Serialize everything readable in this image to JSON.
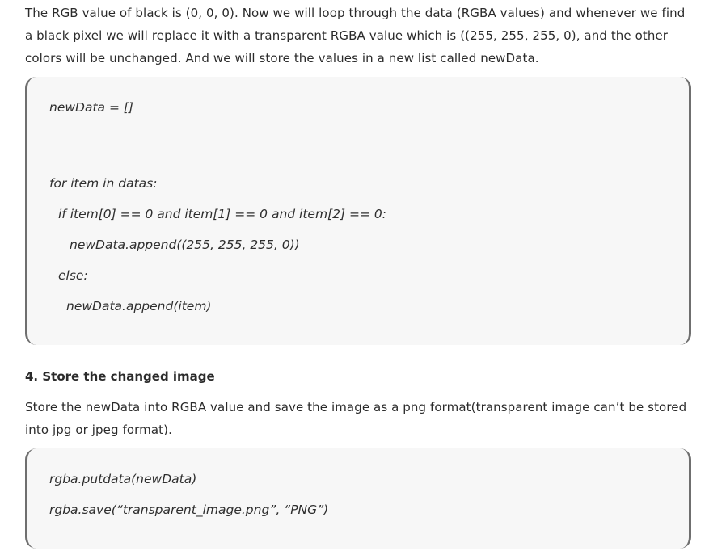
{
  "paragraphs": {
    "intro": "The RGB value of black is (0, 0, 0). Now we will loop through the data (RGBA values) and whenever we find a black pixel we will replace it with a transparent RGBA value which is ((255, 255, 255, 0), and the other colors will be unchanged.  And we will store the values in a new list called newData.",
    "store": "Store the newData into RGBA value and save the image as a png format(transparent image can’t be stored into jpg or jpeg format)."
  },
  "section_heading": "4. Store the changed image",
  "code_block_1": {
    "lines": [
      "newData = []",
      "for item in datas:",
      "if item[0] == 0 and item[1] == 0 and item[2] == 0:",
      "newData.append((255, 255, 255, 0))",
      "else:",
      "newData.append(item)"
    ]
  },
  "code_block_2": {
    "lines": [
      "rgba.putdata(newData)",
      "rgba.save(“transparent_image.png”, “PNG”)"
    ]
  }
}
